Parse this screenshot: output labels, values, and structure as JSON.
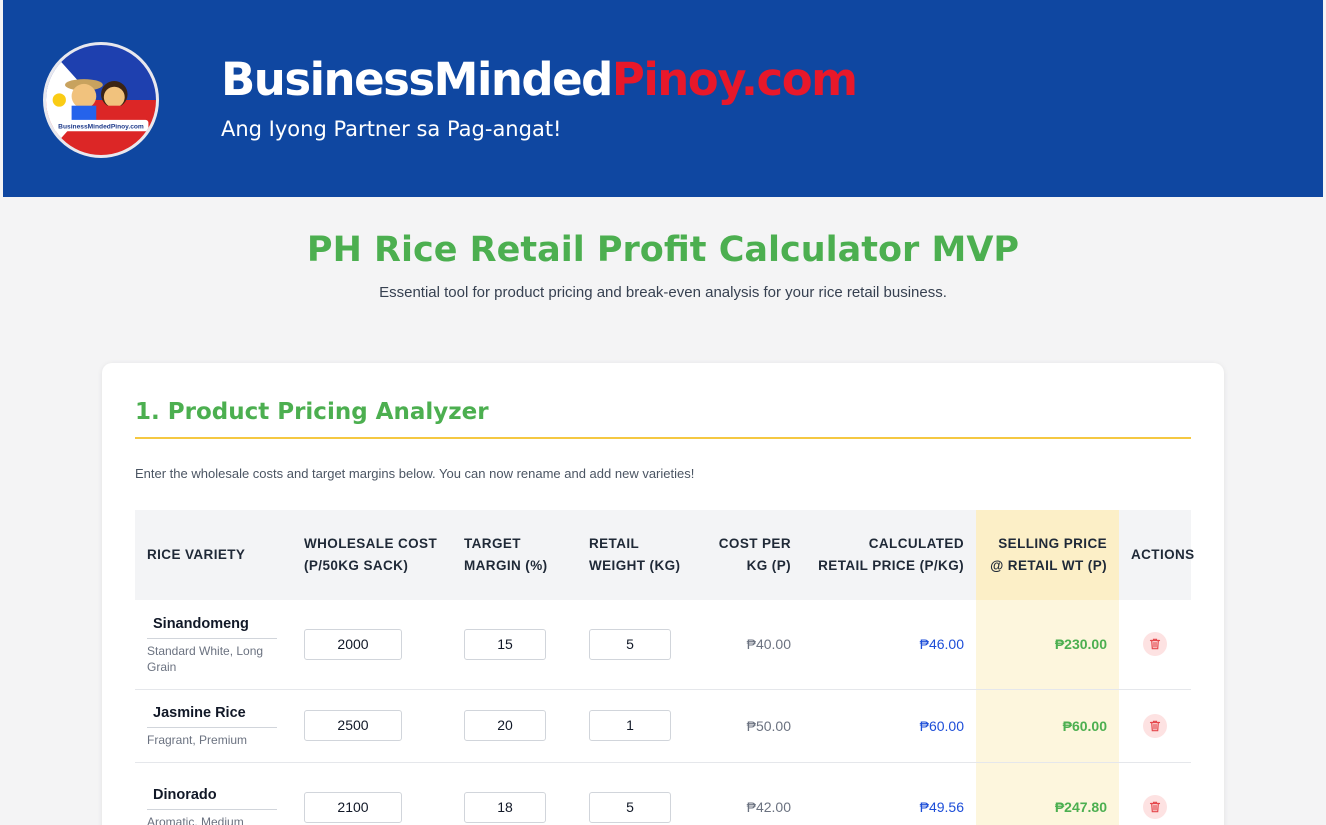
{
  "header": {
    "brand_part1": "BusinessMinded",
    "brand_part2": "Pinoy.com",
    "tagline": "Ang Iyong Partner sa Pag-angat!",
    "logo_text": "BusinessMindedPinoy.com",
    "colors": {
      "background": "#0f47a1",
      "brand_accent": "#e8182a"
    }
  },
  "page": {
    "title": "PH Rice Retail Profit Calculator MVP",
    "subtitle": "Essential tool for product pricing and break-even analysis for your rice retail business."
  },
  "section": {
    "title": "1. Product Pricing Analyzer",
    "instructions": "Enter the wholesale costs and target margins below. You can now rename and add new varieties!"
  },
  "table": {
    "headers": {
      "variety": "Rice Variety",
      "wholesale": "Wholesale Cost (P/50kg Sack)",
      "margin": "Target Margin (%)",
      "weight": "Retail Weight (kg)",
      "cost_per_kg": "Cost per kg (P)",
      "calc_price": "Calculated Retail Price (P/kg)",
      "selling": "Selling Price @ Retail Wt (P)",
      "actions": "Actions"
    },
    "rows": [
      {
        "name": "Sinandomeng",
        "desc": "Standard White, Long Grain",
        "wholesale": "2000",
        "margin": "15",
        "weight": "5",
        "cost_per_kg": "₱40.00",
        "calc_price": "₱46.00",
        "selling": "₱230.00"
      },
      {
        "name": "Jasmine Rice",
        "desc": "Fragrant, Premium",
        "wholesale": "2500",
        "margin": "20",
        "weight": "1",
        "cost_per_kg": "₱50.00",
        "calc_price": "₱60.00",
        "selling": "₱60.00"
      },
      {
        "name": "Dinorado",
        "desc": "Aromatic, Medium",
        "wholesale": "2100",
        "margin": "18",
        "weight": "5",
        "cost_per_kg": "₱42.00",
        "calc_price": "₱49.56",
        "selling": "₱247.80"
      }
    ],
    "delete_icon": "trash-icon"
  }
}
